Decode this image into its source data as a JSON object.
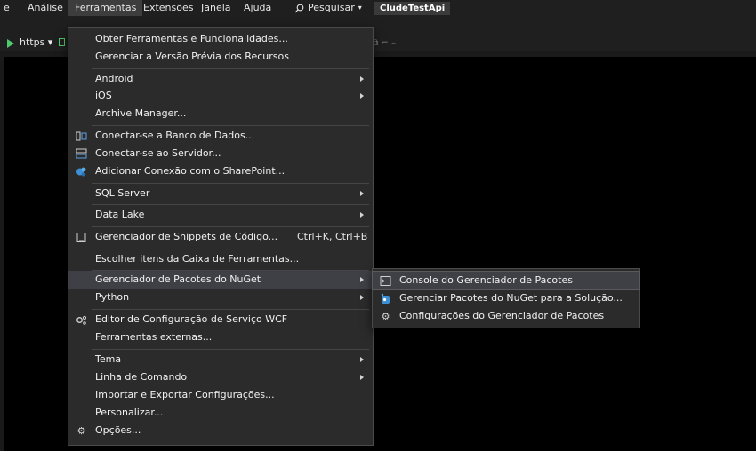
{
  "menubar": {
    "items": [
      "e",
      "Análise",
      "Ferramentas",
      "Extensões",
      "Janela",
      "Ajuda"
    ],
    "search_label": "Pesquisar",
    "project_name": "CludeTestApi"
  },
  "toolbar": {
    "run_label": "https"
  },
  "tools_menu": {
    "items": [
      {
        "label": "Obter Ferramentas e Funcionalidades..."
      },
      {
        "label": "Gerenciar a Versão Prévia dos Recursos"
      },
      {
        "label": "Android",
        "submenu": true
      },
      {
        "label": "iOS",
        "submenu": true
      },
      {
        "label": "Archive Manager..."
      },
      {
        "label": "Conectar-se a Banco de Dados...",
        "icon": "database-connect-icon"
      },
      {
        "label": "Conectar-se ao Servidor...",
        "icon": "server-connect-icon"
      },
      {
        "label": "Adicionar Conexão com o SharePoint...",
        "icon": "sharepoint-icon"
      },
      {
        "label": "SQL Server",
        "submenu": true
      },
      {
        "label": "Data Lake",
        "submenu": true
      },
      {
        "label": "Gerenciador de Snippets de Código...",
        "icon": "snippet-icon",
        "shortcut": "Ctrl+K, Ctrl+B"
      },
      {
        "label": "Escolher itens da Caixa de Ferramentas..."
      },
      {
        "label": "Gerenciador de Pacotes do NuGet",
        "submenu": true,
        "highlighted": true
      },
      {
        "label": "Python",
        "submenu": true
      },
      {
        "label": "Editor de Configuração de Serviço WCF",
        "icon": "wcf-config-icon"
      },
      {
        "label": "Ferramentas externas..."
      },
      {
        "label": "Tema",
        "submenu": true
      },
      {
        "label": "Linha de Comando",
        "submenu": true
      },
      {
        "label": "Importar e Exportar Configurações..."
      },
      {
        "label": "Personalizar..."
      },
      {
        "label": "Opções...",
        "icon": "gear-icon"
      }
    ]
  },
  "nuget_submenu": {
    "items": [
      {
        "label": "Console do Gerenciador de Pacotes",
        "icon": "console-icon",
        "highlighted": true
      },
      {
        "label": "Gerenciar Pacotes do NuGet para a Solução...",
        "icon": "nuget-icon"
      },
      {
        "label": "Configurações do Gerenciador de Pacotes",
        "icon": "gear-icon"
      }
    ]
  },
  "colors": {
    "background": "#1f1f1f",
    "menu_bg": "#2b2b2b",
    "highlight": "#3f3f46",
    "run_green": "#4ec96e"
  }
}
